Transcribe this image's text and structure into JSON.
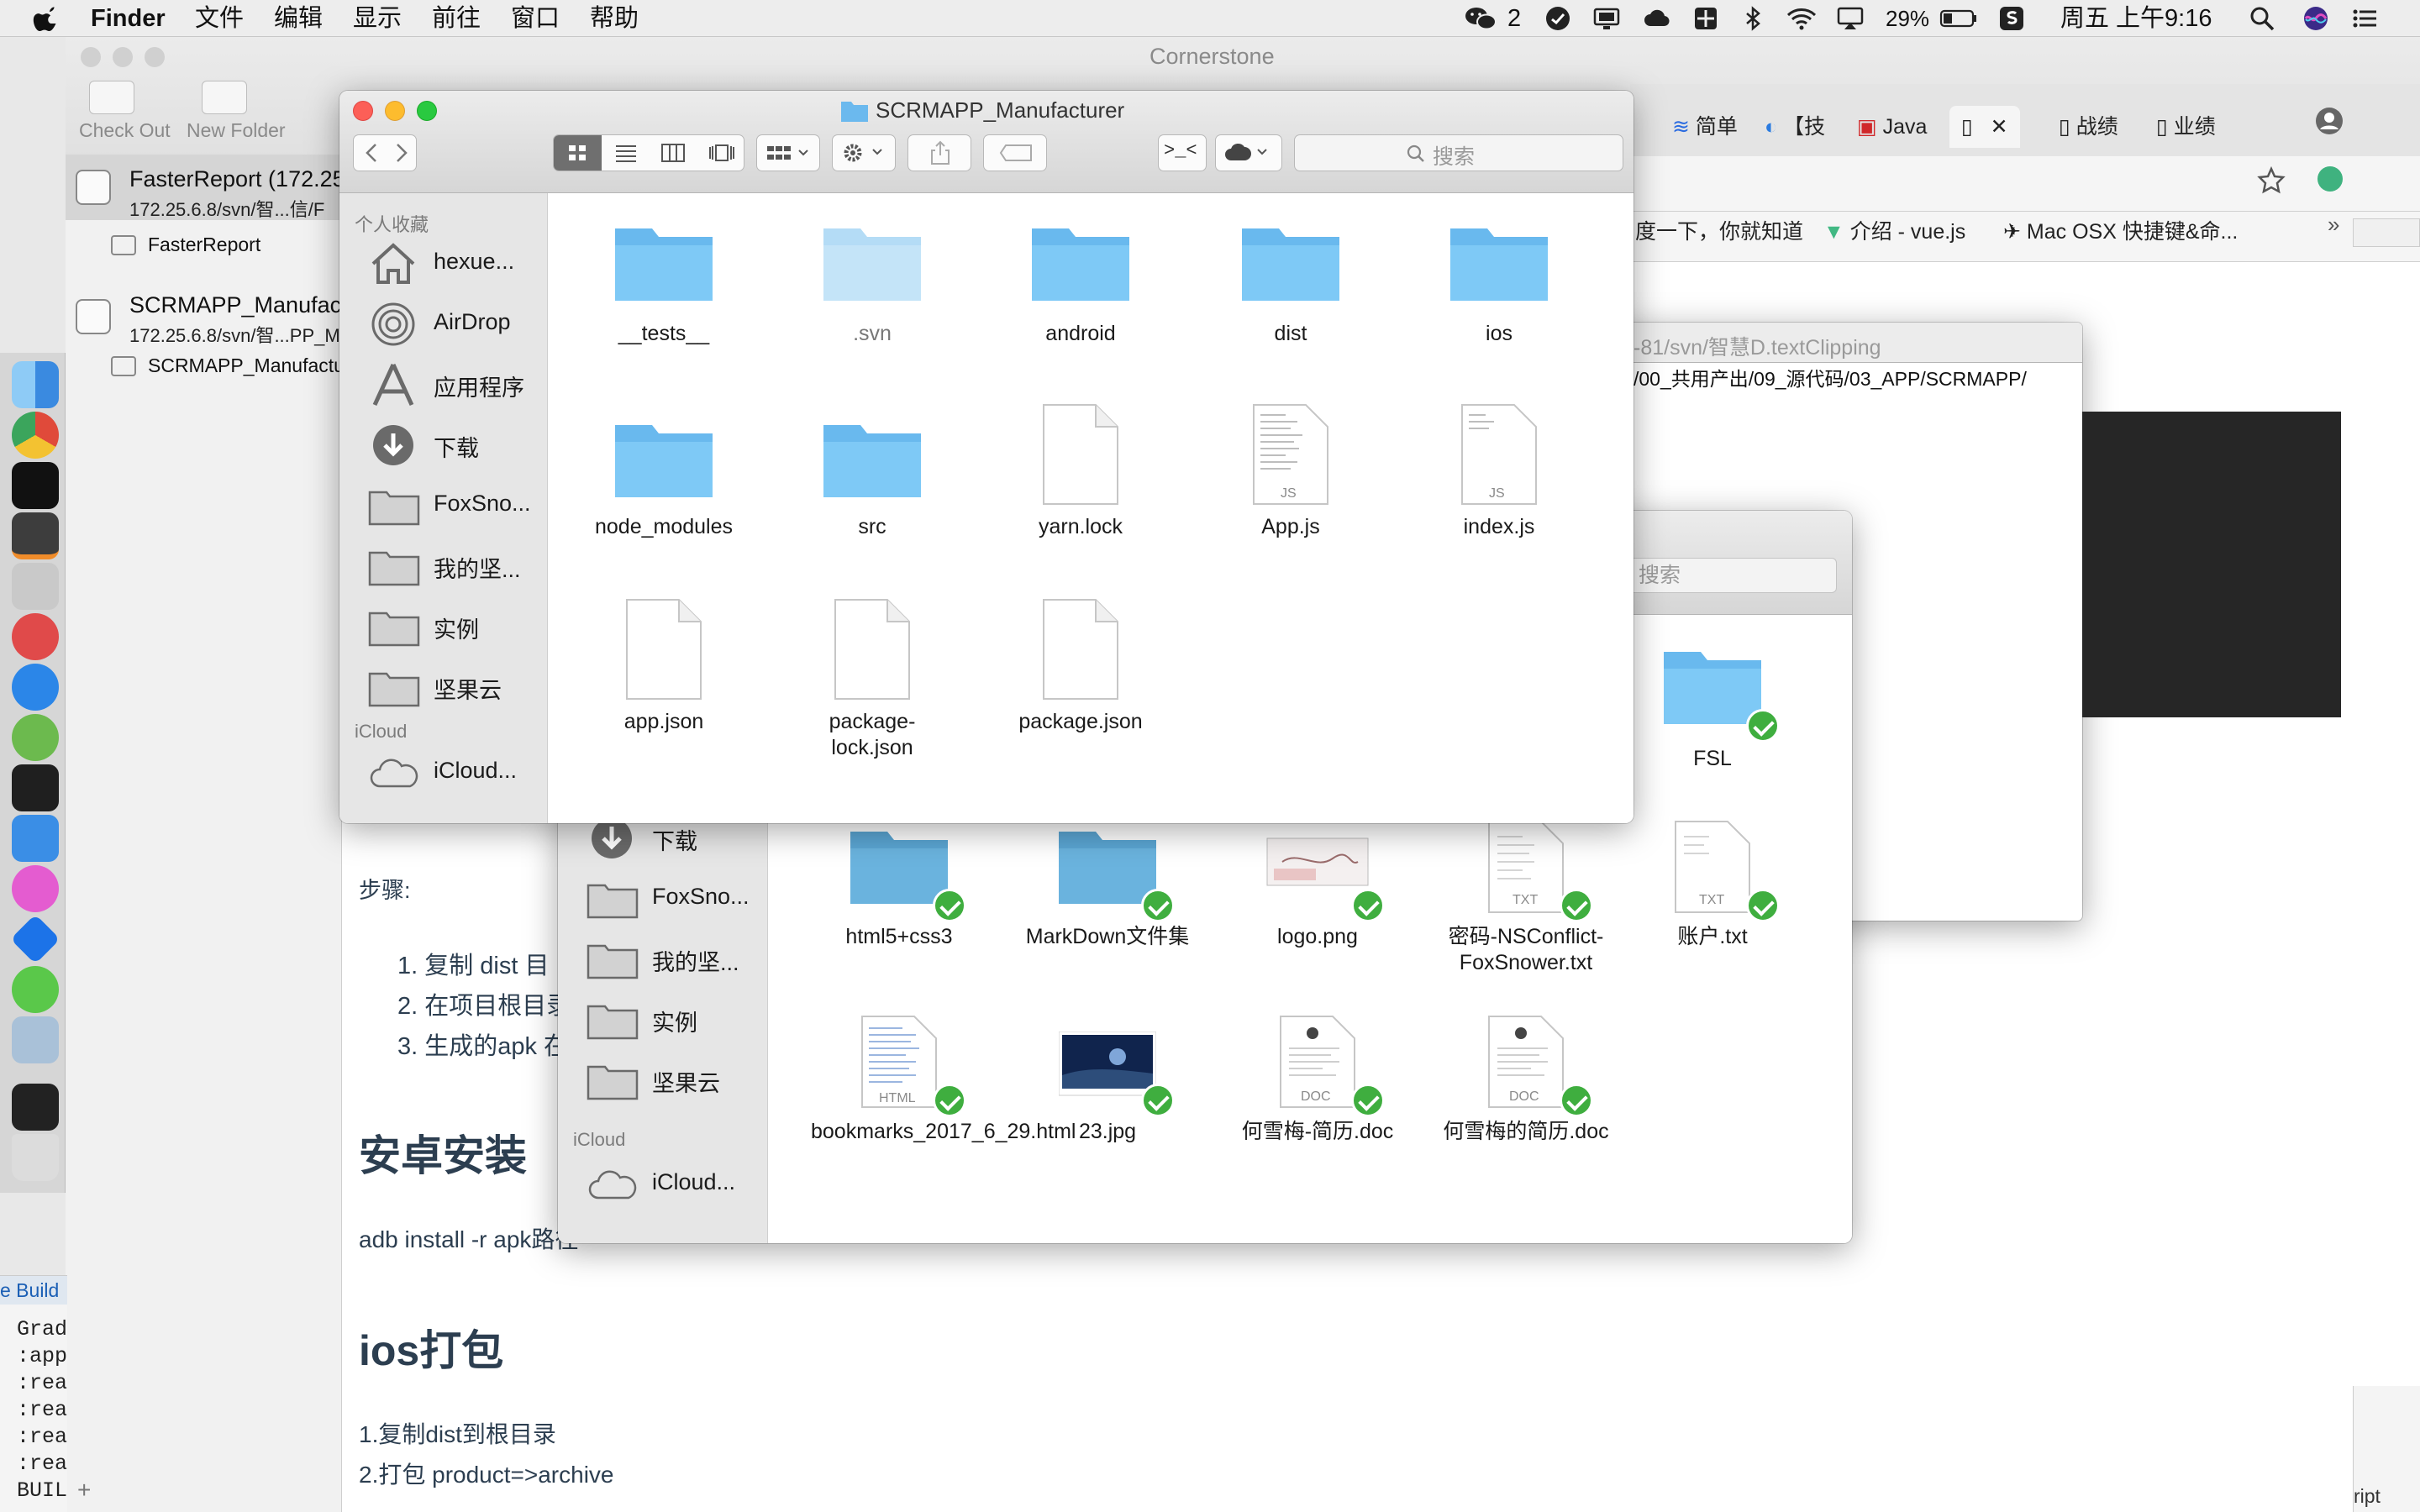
{
  "menubar": {
    "app": "Finder",
    "menus": [
      "文件",
      "编辑",
      "显示",
      "前往",
      "窗口",
      "帮助"
    ],
    "wechat_count": "2",
    "battery": "29%",
    "clock": "周五 上午9:16"
  },
  "cornerstone": {
    "title": "Cornerstone",
    "toolbar": {
      "checkout": "Check Out",
      "new_folder": "New Folder"
    },
    "repos": [
      {
        "name": "FasterReport (172.25",
        "path": "172.25.6.8/svn/智...信/F",
        "child": "FasterReport"
      },
      {
        "name": "SCRMAPP_Manufact",
        "path": "172.25.6.8/svn/智...PP_M",
        "child": "SCRMAPP_Manufactu"
      }
    ],
    "build_label": "e Build",
    "log_lines": [
      "Grad",
      ":app:",
      ":reac",
      ":reac",
      ":reac",
      ":reac",
      "BUIL"
    ]
  },
  "browser": {
    "tabs": [
      "简单",
      "【技",
      "Java",
      " ",
      "战绩",
      "业绩"
    ],
    "bookmarks": [
      "度一下，你就知道",
      "介绍 - vue.js",
      "Mac OSX 快捷键&命..."
    ]
  },
  "clipping": {
    "title": "-81/svn/智慧D.textClipping",
    "content": "/00_共用产出/09_源代码/03_APP/SCRMAPP/"
  },
  "document": {
    "steps_label": "步骤:",
    "steps": [
      "1. 复制 dist 目",
      "2. 在项目根目录",
      "3. 生成的apk 在"
    ],
    "android_heading": "安卓安装",
    "adb": "adb install -r apk路径",
    "ios_heading": "ios打包",
    "ios_steps": [
      "1.复制dist到根目录",
      "2.打包 product=>archive"
    ]
  },
  "finder_back": {
    "search_placeholder": "搜索",
    "sidebar": [
      "下载",
      "FoxSno...",
      "我的坚...",
      "实例",
      "坚果云"
    ],
    "icloud_header": "iCloud",
    "icloud_item": "iCloud...",
    "files": [
      {
        "name": "FSL",
        "kind": "folder"
      },
      {
        "name": "html5+css3",
        "kind": "folder"
      },
      {
        "name": "MarkDown文件集",
        "kind": "folder"
      },
      {
        "name": "logo.png",
        "kind": "image"
      },
      {
        "name": "密码-NSConflict-FoxSnower.txt",
        "kind": "txt",
        "tag": "TXT"
      },
      {
        "name": "账户.txt",
        "kind": "txt",
        "tag": "TXT"
      },
      {
        "name": "bookmarks_2017_6_29.html",
        "kind": "html",
        "tag": "HTML"
      },
      {
        "name": "23.jpg",
        "kind": "photo"
      },
      {
        "name": "何雪梅-简历.doc",
        "kind": "doc",
        "tag": "DOC"
      },
      {
        "name": "何雪梅的简历.doc",
        "kind": "doc",
        "tag": "DOC"
      }
    ]
  },
  "finder": {
    "title": "SCRMAPP_Manufacturer",
    "search_placeholder": "搜索",
    "favorites_header": "个人收藏",
    "sidebar": [
      {
        "label": "hexue...",
        "icon": "home-icon"
      },
      {
        "label": "AirDrop",
        "icon": "airdrop-icon"
      },
      {
        "label": "应用程序",
        "icon": "applications-icon"
      },
      {
        "label": "下载",
        "icon": "downloads-icon"
      },
      {
        "label": "FoxSno...",
        "icon": "folder-icon"
      },
      {
        "label": "我的坚...",
        "icon": "folder-icon"
      },
      {
        "label": "实例",
        "icon": "folder-icon"
      },
      {
        "label": "坚果云",
        "icon": "folder-icon"
      }
    ],
    "icloud_header": "iCloud",
    "icloud_item": "iCloud...",
    "files": [
      {
        "name": "__tests__",
        "kind": "folder"
      },
      {
        "name": ".svn",
        "kind": "folder-hidden"
      },
      {
        "name": "android",
        "kind": "folder"
      },
      {
        "name": "dist",
        "kind": "folder"
      },
      {
        "name": "ios",
        "kind": "folder"
      },
      {
        "name": "node_modules",
        "kind": "folder"
      },
      {
        "name": "src",
        "kind": "folder"
      },
      {
        "name": "yarn.lock",
        "kind": "file"
      },
      {
        "name": "App.js",
        "kind": "js",
        "tag": "JS"
      },
      {
        "name": "index.js",
        "kind": "js",
        "tag": "JS"
      },
      {
        "name": "app.json",
        "kind": "file"
      },
      {
        "name": "package-lock.json",
        "kind": "file"
      },
      {
        "name": "package.json",
        "kind": "file"
      }
    ]
  },
  "right_edge": {
    "line1": "ript"
  }
}
